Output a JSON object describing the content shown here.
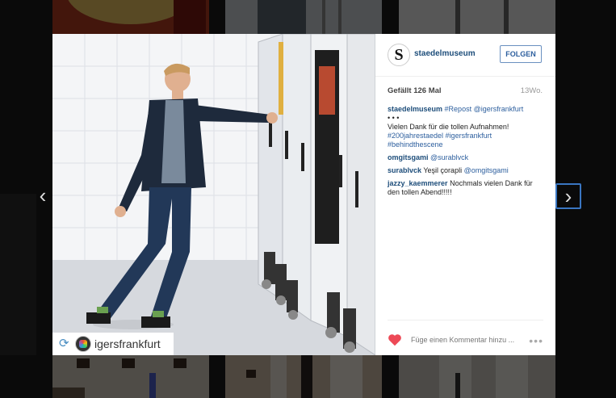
{
  "post": {
    "username": "staedelmuseum",
    "follow_label": "FOLGEN",
    "likes": "Gefällt 126 Mal",
    "age": "13Wo.",
    "avatar_letter": "S",
    "caption": {
      "user": "staedelmuseum",
      "tags1": "#Repost @igersfrankfurt",
      "dots": "• • •",
      "text": "Vielen Dank für die tollen Aufnahmen!",
      "tags2": "#200jahrestaedel #igersfrankfurt #behindthescene"
    },
    "comments": [
      {
        "user": "omgitsgami",
        "text": "@surablvck",
        "is_tag": true
      },
      {
        "user": "surablvck",
        "text": "Yeşil çorapli ",
        "mention": "@omgitsgami"
      },
      {
        "user": "jazzy_kaemmerer",
        "text": "Nochmals vielen Dank für den tollen Abend!!!!!"
      }
    ],
    "comment_placeholder": "Füge einen Kommentar hinzu ...",
    "more_label": "•••",
    "repost_name": "igersfrankfurt"
  },
  "nav": {
    "prev": "‹",
    "next": "›"
  },
  "colors": {
    "accent": "#2d5f9e",
    "like": "#ed4956"
  }
}
